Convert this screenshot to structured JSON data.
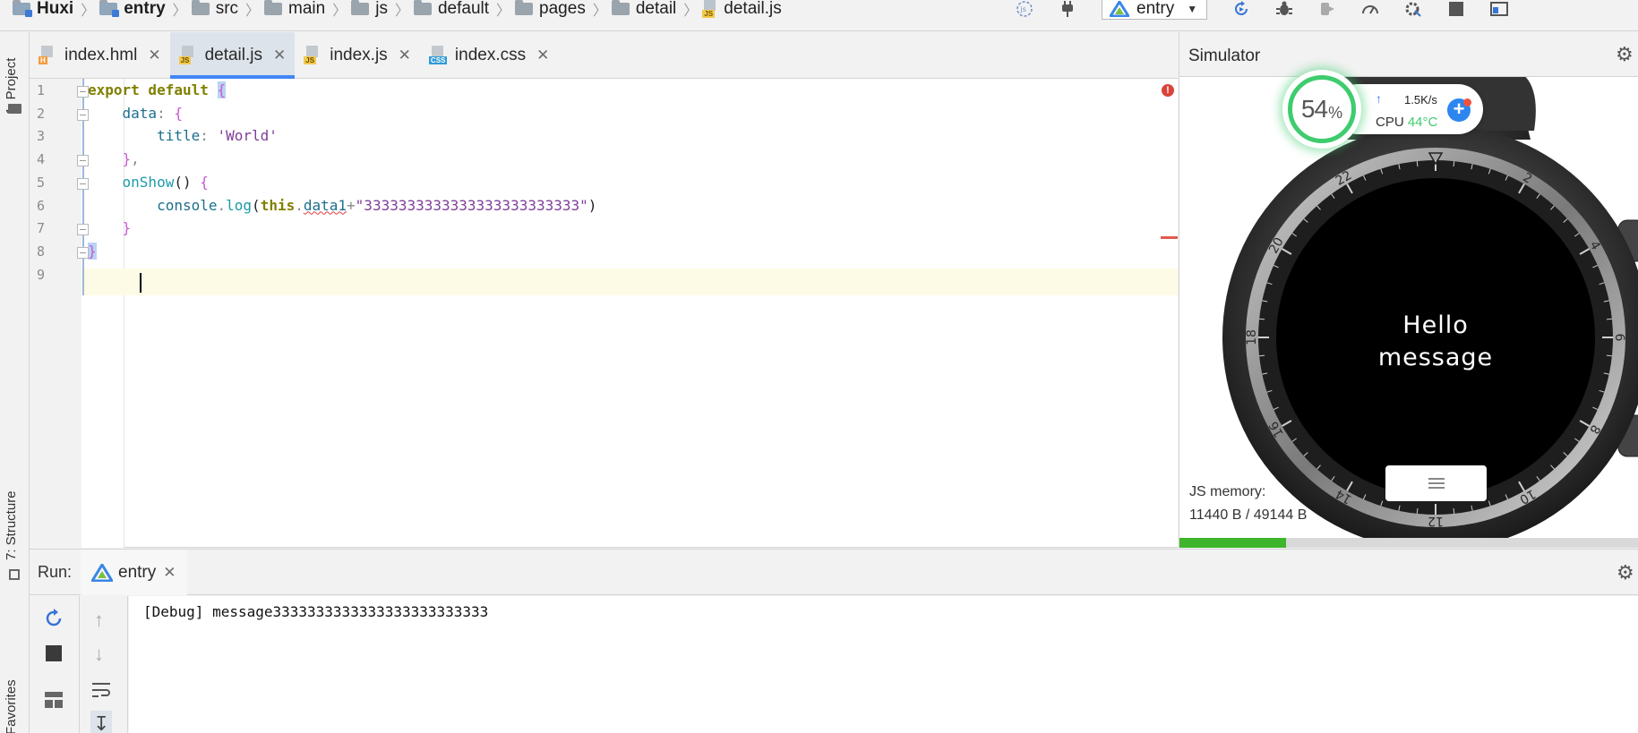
{
  "breadcrumb": [
    {
      "label": "Huxi",
      "bold": true,
      "kind": "module"
    },
    {
      "label": "entry",
      "bold": true,
      "kind": "module"
    },
    {
      "label": "src",
      "kind": "folder"
    },
    {
      "label": "main",
      "kind": "folder"
    },
    {
      "label": "js",
      "kind": "folder"
    },
    {
      "label": "default",
      "kind": "folder"
    },
    {
      "label": "pages",
      "kind": "folder"
    },
    {
      "label": "detail",
      "kind": "folder"
    },
    {
      "label": "detail.js",
      "kind": "jsfile"
    }
  ],
  "toolbar": {
    "run_config": "entry",
    "icons": [
      "js-plugin-icon",
      "plug-icon",
      "device-icon",
      "rerun-icon",
      "bug-icon",
      "attach-icon",
      "profiler-icon",
      "hot-reload-icon",
      "stop-icon",
      "layout-icon"
    ]
  },
  "left_strip": {
    "project_tab": "1: Project",
    "structure_tab": "7: Structure",
    "favorites_tab": "Favorites"
  },
  "editor_tabs": [
    {
      "label": "index.hml",
      "icon": "hml-file-icon",
      "badge": "H",
      "kind": "h",
      "active": false
    },
    {
      "label": "detail.js",
      "icon": "js-file-icon",
      "badge": "JS",
      "kind": "js",
      "active": true
    },
    {
      "label": "index.js",
      "icon": "js-file-icon",
      "badge": "JS",
      "kind": "js",
      "active": false
    },
    {
      "label": "index.css",
      "icon": "css-file-icon",
      "badge": "CSS",
      "kind": "css",
      "active": false
    }
  ],
  "code": {
    "line_numbers": [
      "1",
      "2",
      "3",
      "4",
      "5",
      "6",
      "7",
      "8",
      "9"
    ],
    "lines": [
      [
        {
          "t": "export default ",
          "c": "kw"
        },
        {
          "t": "{",
          "c": "brace hl-brace"
        }
      ],
      [
        {
          "t": "    ",
          "c": "plain"
        },
        {
          "t": "data",
          "c": "prop"
        },
        {
          "t": ": ",
          "c": "dim"
        },
        {
          "t": "{",
          "c": "brace"
        }
      ],
      [
        {
          "t": "        ",
          "c": "plain"
        },
        {
          "t": "title",
          "c": "prop"
        },
        {
          "t": ": ",
          "c": "dim"
        },
        {
          "t": "'World'",
          "c": "strpurple"
        }
      ],
      [
        {
          "t": "    ",
          "c": "plain"
        },
        {
          "t": "}",
          "c": "brace"
        },
        {
          "t": ",",
          "c": "dim"
        }
      ],
      [
        {
          "t": "    ",
          "c": "plain"
        },
        {
          "t": "onShow",
          "c": "fn"
        },
        {
          "t": "() ",
          "c": "plain"
        },
        {
          "t": "{",
          "c": "brace"
        }
      ],
      [
        {
          "t": "        ",
          "c": "plain"
        },
        {
          "t": "console",
          "c": "prop"
        },
        {
          "t": ".",
          "c": "dim"
        },
        {
          "t": "log",
          "c": "fn"
        },
        {
          "t": "(",
          "c": "plain"
        },
        {
          "t": "this",
          "c": "kw"
        },
        {
          "t": ".",
          "c": "dim"
        },
        {
          "t": "data1",
          "c": "prop squiggle"
        },
        {
          "t": "+",
          "c": "dim"
        },
        {
          "t": "\"3333333333333333333333333\"",
          "c": "strpurple"
        },
        {
          "t": ")",
          "c": "plain"
        }
      ],
      [
        {
          "t": "    ",
          "c": "plain"
        },
        {
          "t": "}",
          "c": "brace"
        }
      ],
      [
        {
          "t": "}",
          "c": "brace hl-brace"
        }
      ],
      []
    ]
  },
  "simulator": {
    "title": "Simulator",
    "watch_text_line1": "Hello",
    "watch_text_line2": "message",
    "bezel_numbers": [
      "2",
      "4",
      "6",
      "8",
      "10",
      "12",
      "14",
      "16",
      "18",
      "20",
      "22"
    ],
    "js_memory_label": "JS memory:",
    "js_memory_value": "11440 B / 49144 B",
    "memory_used_bytes": 11440,
    "memory_total_bytes": 49144
  },
  "perf": {
    "percent": "54",
    "percent_unit": "%",
    "net_speed": "1.5K/s",
    "cpu_label": "CPU",
    "cpu_temp": "44°C"
  },
  "run_panel": {
    "label": "Run:",
    "tab": "entry",
    "console_output": "[Debug] message3333333333333333333333333"
  },
  "colors": {
    "accent": "#4285f4",
    "error": "#d9443a",
    "ok_green": "#3ecc6e",
    "memory_green": "#3eb52b"
  }
}
